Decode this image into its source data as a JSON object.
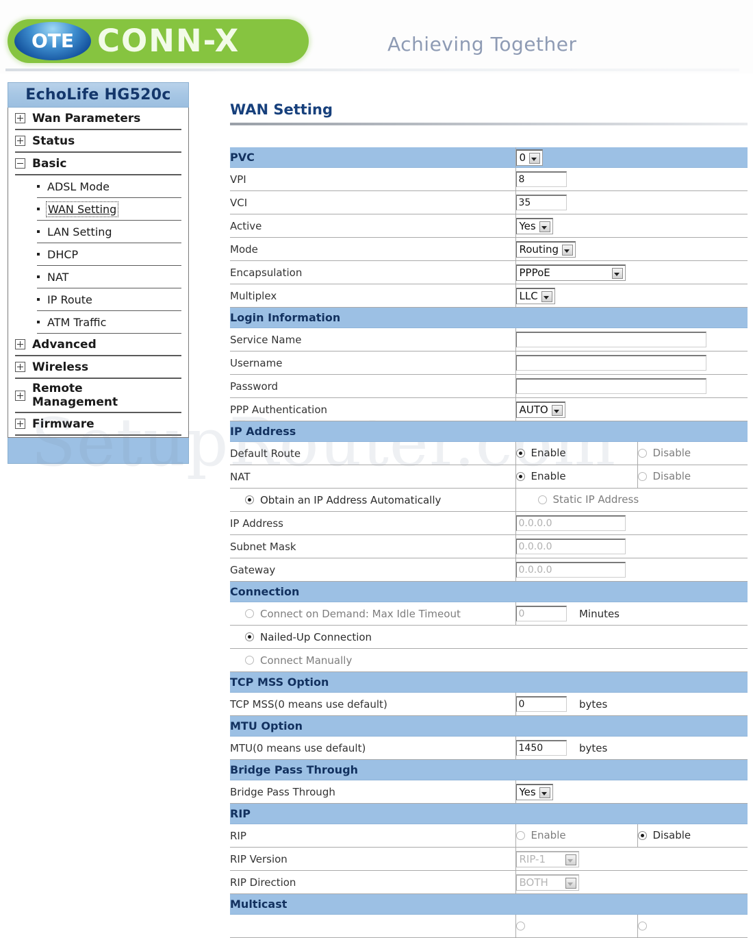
{
  "banner": {
    "logo_ote": "OTE",
    "logo_connx": "CONN-X",
    "tagline": "Achieving Together",
    "green": "#86c440",
    "blue": "#13519c"
  },
  "sidebar": {
    "title": "EchoLife HG520c",
    "items": [
      {
        "label": "Wan Parameters",
        "type": "group",
        "expander": "plus"
      },
      {
        "label": "Status",
        "type": "group",
        "expander": "plus"
      },
      {
        "label": "Basic",
        "type": "group",
        "expander": "minus"
      },
      {
        "label": "ADSL Mode",
        "type": "sub",
        "selected": false
      },
      {
        "label": "WAN Setting",
        "type": "sub",
        "selected": true
      },
      {
        "label": "LAN Setting",
        "type": "sub",
        "selected": false
      },
      {
        "label": "DHCP",
        "type": "sub",
        "selected": false
      },
      {
        "label": "NAT",
        "type": "sub",
        "selected": false
      },
      {
        "label": "IP Route",
        "type": "sub",
        "selected": false
      },
      {
        "label": "ATM Traffic",
        "type": "sub",
        "selected": false
      },
      {
        "label": "Advanced",
        "type": "group",
        "expander": "plus"
      },
      {
        "label": "Wireless",
        "type": "group",
        "expander": "plus"
      },
      {
        "label": "Remote Management",
        "type": "group",
        "expander": "plus"
      },
      {
        "label": "Firmware",
        "type": "group",
        "expander": "plus"
      }
    ]
  },
  "main": {
    "page_title": "WAN Setting",
    "sections": {
      "pvc": {
        "header": "PVC",
        "header_value": "0",
        "vpi_label": "VPI",
        "vpi_value": "8",
        "vci_label": "VCI",
        "vci_value": "35",
        "active_label": "Active",
        "active_value": "Yes",
        "mode_label": "Mode",
        "mode_value": "Routing",
        "encapsulation_label": "Encapsulation",
        "encapsulation_value": "PPPoE",
        "multiplex_label": "Multiplex",
        "multiplex_value": "LLC"
      },
      "login": {
        "header": "Login Information",
        "service_name_label": "Service Name",
        "service_name_value": "",
        "username_label": "Username",
        "username_value": "",
        "password_label": "Password",
        "password_value": "",
        "ppp_auth_label": "PPP Authentication",
        "ppp_auth_value": "AUTO"
      },
      "ip_address": {
        "header": "IP Address",
        "default_route_label": "Default Route",
        "default_route_enable": "Enable",
        "default_route_disable": "Disable",
        "default_route_selected": "Enable",
        "nat_label": "NAT",
        "nat_enable": "Enable",
        "nat_disable": "Disable",
        "nat_selected": "Enable",
        "obtain_auto_label": "Obtain an IP Address Automatically",
        "static_ip_label": "Static IP Address",
        "ip_mode_selected": "Obtain an IP Address Automatically",
        "ip_address_label": "IP Address",
        "ip_address_value": "0.0.0.0",
        "subnet_mask_label": "Subnet Mask",
        "subnet_mask_value": "0.0.0.0",
        "gateway_label": "Gateway",
        "gateway_value": "0.0.0.0"
      },
      "connection": {
        "header": "Connection",
        "on_demand_label": "Connect on Demand: Max Idle Timeout",
        "on_demand_value": "0",
        "on_demand_unit": "Minutes",
        "nailed_up_label": "Nailed-Up Connection",
        "manual_label": "Connect Manually",
        "selected": "Nailed-Up Connection"
      },
      "tcp_mss": {
        "header": "TCP MSS Option",
        "label": "TCP MSS(0 means use default)",
        "value": "0",
        "unit": "bytes"
      },
      "mtu": {
        "header": "MTU Option",
        "label": "MTU(0 means use default)",
        "value": "1450",
        "unit": "bytes"
      },
      "bridge": {
        "header": "Bridge Pass Through",
        "label": "Bridge Pass Through",
        "value": "Yes"
      },
      "rip": {
        "header": "RIP",
        "rip_label": "RIP",
        "rip_enable": "Enable",
        "rip_disable": "Disable",
        "rip_selected": "Disable",
        "version_label": "RIP Version",
        "version_value": "RIP-1",
        "direction_label": "RIP Direction",
        "direction_value": "BOTH"
      },
      "multicast": {
        "header": "Multicast"
      }
    }
  },
  "watermark": {
    "text1": "SetupRouter.com",
    "text2": ""
  },
  "colors": {
    "section_header_bg": "#9cc0e4",
    "title_text": "#17407c",
    "accent_green": "#86c440"
  }
}
